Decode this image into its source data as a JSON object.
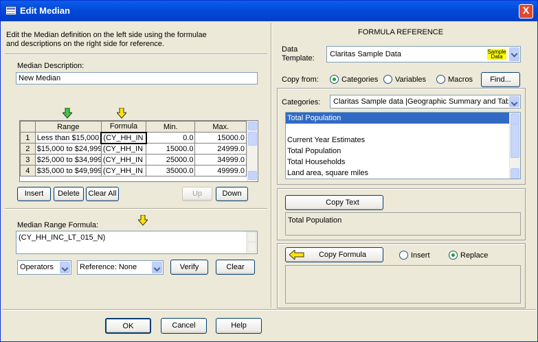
{
  "window": {
    "title": "Edit Median",
    "close_label": "X"
  },
  "left": {
    "intro": "Edit the Median definition on the left side using the formulae",
    "intro2": "and descriptions on the right side for reference.",
    "desc_label": "Median Description:",
    "desc_value": "New Median",
    "grid": {
      "headers": [
        "Range",
        "Formula",
        "Min.",
        "Max."
      ],
      "rows": [
        {
          "num": "1",
          "range": "Less than $15,000",
          "formula": "(CY_HH_IN",
          "min": "0.0",
          "max": "15000.0"
        },
        {
          "num": "2",
          "range": "$15,000 to $24,999",
          "formula": "(CY_HH_IN",
          "min": "15000.0",
          "max": "24999.0"
        },
        {
          "num": "3",
          "range": "$25,000 to $34,999",
          "formula": "(CY_HH_IN",
          "min": "25000.0",
          "max": "34999.0"
        },
        {
          "num": "4",
          "range": "$35,000 to $49,999",
          "formula": "(CY_HH_IN",
          "min": "35000.0",
          "max": "49999.0"
        }
      ]
    },
    "buttons": {
      "insert": "Insert",
      "delete": "Delete",
      "clear_all": "Clear All",
      "up": "Up",
      "down": "Down"
    },
    "range_formula_label": "Median Range Formula:",
    "range_formula_value": "(CY_HH_INC_LT_015_N)",
    "operators": "Operators",
    "reference": "Reference: None",
    "verify": "Verify",
    "clear": "Clear"
  },
  "right": {
    "title": "FORMULA REFERENCE",
    "template_label1": "Data",
    "template_label2": "Template:",
    "template_value": "Claritas Sample Data",
    "template_badge1": "Sample",
    "template_badge2": "Data",
    "copy_from": "Copy from:",
    "radio_categories": "Categories",
    "radio_variables": "Variables",
    "radio_macros": "Macros",
    "find": "Find...",
    "categories_label": "Categories:",
    "categories_value": "Claritas Sample data |Geographic Summary and Tabl",
    "list": [
      "Total Population",
      "",
      "Current Year Estimates",
      "Total Population",
      "Total Households",
      "Land area, square miles"
    ],
    "copy_text": "Copy Text",
    "copy_text_value": "Total Population",
    "copy_formula": "Copy Formula",
    "radio_insert": "Insert",
    "radio_replace": "Replace"
  },
  "footer": {
    "ok": "OK",
    "cancel": "Cancel",
    "help": "Help"
  },
  "colors": {
    "accent": "#316ac5",
    "green_arrow": "#3cc93c",
    "yellow_arrow": "#ffe400",
    "badge": "#ffff00"
  }
}
